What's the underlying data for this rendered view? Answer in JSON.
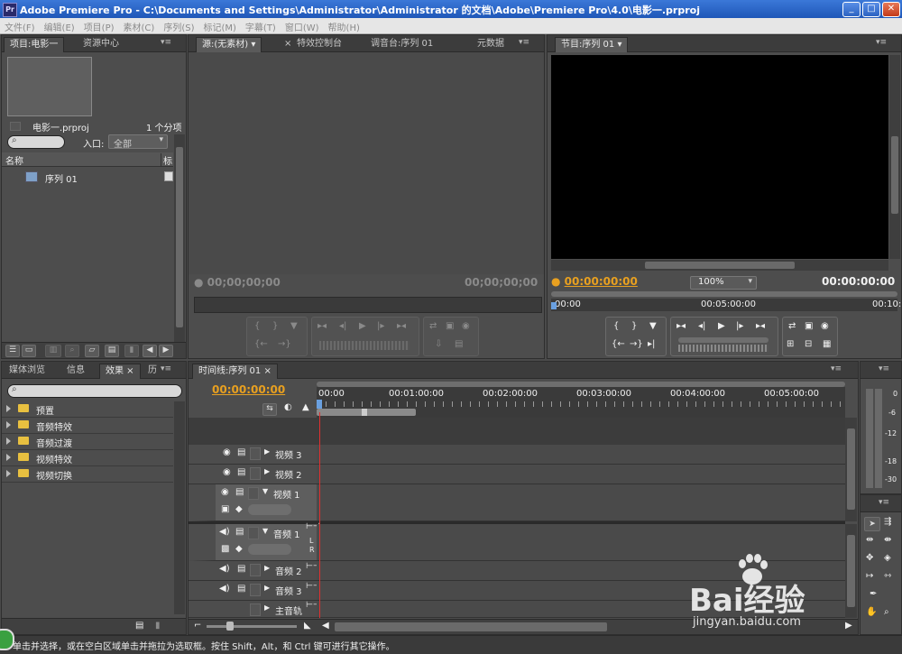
{
  "window": {
    "title": "Adobe Premiere Pro - C:\\Documents and Settings\\Administrator\\Administrator 的文档\\Adobe\\Premiere Pro\\4.0\\电影一.prproj",
    "logo": "Pr",
    "minimize": "_",
    "maximize": "□",
    "close": "✕"
  },
  "menu": [
    "文件(F)",
    "编辑(E)",
    "项目(P)",
    "素材(C)",
    "序列(S)",
    "标记(M)",
    "字幕(T)",
    "窗口(W)",
    "帮助(H)"
  ],
  "project": {
    "tab_project": "项目:电影一",
    "tab_resources": "资源中心",
    "project_name": "电影一.prproj",
    "item_count": "1 个分项",
    "entry_label": "入口:",
    "entry_value": "全部",
    "col_name": "名称",
    "col_label": "标",
    "items": [
      "序列 01"
    ]
  },
  "source": {
    "tab_source": "源:(无素材)",
    "tab_effect_controls": "特效控制台",
    "tab_audio_mixer": "调音台:序列 01",
    "tab_metadata": "元数据",
    "timecode_left": "00;00;00;00",
    "timecode_right": "00;00;00;00"
  },
  "program": {
    "tab": "节目:序列 01",
    "timecode_current": "00:00:00:00",
    "zoom": "100%",
    "timecode_duration": "00:00:00:00",
    "ruler_start": "00:00",
    "ruler_mid": "00:05:00:00",
    "ruler_end": "00:10:"
  },
  "effects": {
    "tab_media": "媒体浏览",
    "tab_info": "信息",
    "tab_effects": "效果",
    "tab_history": "历",
    "folders": [
      "预置",
      "音频特效",
      "音频过渡",
      "视频特效",
      "视频切换"
    ]
  },
  "timeline": {
    "tab": "时间线:序列 01",
    "timecode": "00:00:00:00",
    "ruler": [
      "00:00",
      "00:01:00:00",
      "00:02:00:00",
      "00:03:00:00",
      "00:04:00:00",
      "00:05:00:00"
    ],
    "tracks": {
      "video3": "视频 3",
      "video2": "视频 2",
      "video1": "视频 1",
      "audio1": "音频 1",
      "audio2": "音频 2",
      "audio3": "音频 3",
      "master": "主音轨"
    },
    "lr_l": "L",
    "lr_r": "R"
  },
  "audio_meter": {
    "labels": [
      "0",
      "-6",
      "-12",
      "-18",
      "-30"
    ]
  },
  "status": {
    "text": "单击并选择，或在空白区域单击并拖拉为选取框。按住 Shift，Alt，和 Ctrl 键可进行其它操作。"
  },
  "watermark": {
    "brand": "Bai经验",
    "url": "jingyan.baidu.com"
  },
  "colors": {
    "accent_timecode": "#e8a020",
    "playhead": "#e03030",
    "title_bar": "#1f57b8"
  }
}
